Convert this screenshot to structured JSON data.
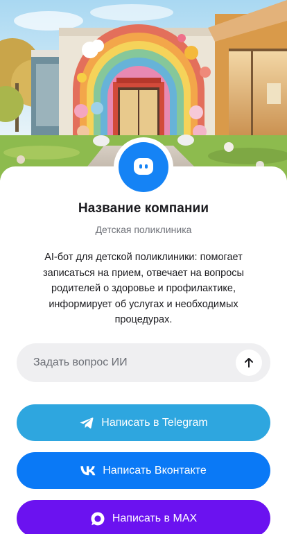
{
  "company": {
    "name": "Название компании",
    "type": "Детская поликлиника",
    "description": "AI-бот для детской поликлиники: помогает записаться на прием, отвечает на вопросы родителей о здоровье и профилактике, информирует об услугах и необходимых процедурах."
  },
  "ask": {
    "placeholder": "Задать вопрос ИИ",
    "send_icon": "arrow-up-icon"
  },
  "buttons": {
    "telegram": {
      "label": "Написать в Telegram",
      "icon": "telegram-icon",
      "color": "#2ea6df"
    },
    "vk": {
      "label": "Написать Вконтакте",
      "icon": "vk-icon",
      "color": "#0a79f6"
    },
    "max": {
      "label": "Написать в MAX",
      "icon": "max-icon",
      "color": "#6b12f0"
    }
  },
  "colors": {
    "avatar": "#1583f5",
    "ask_background": "#efeff1"
  },
  "icons": {
    "avatar": "chat-bot-icon"
  }
}
